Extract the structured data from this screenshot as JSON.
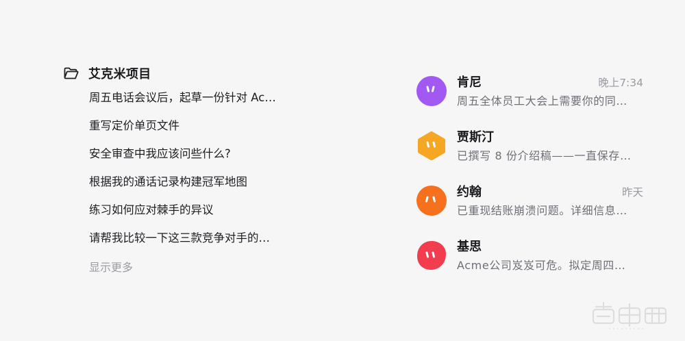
{
  "project": {
    "icon": "folder-open-icon",
    "title": "艾克米项目",
    "threads": [
      "周五电话会议后，起草一份针对 Ac…",
      "重写定价单页文件",
      "安全审查中我应该问些什么?",
      "根据我的通话记录构建冠军地图",
      "练习如何应对棘手的异议",
      "请帮我比较一下这三款竞争对手的…"
    ],
    "show_more": "显示更多"
  },
  "chats": [
    {
      "name": "肯尼",
      "time": "晚上7:34",
      "preview": "周五全体员工大会上需要你的同…",
      "avatar_color": "#a259f4",
      "avatar_shape": "circle"
    },
    {
      "name": "贾斯汀",
      "time": "",
      "preview": "已撰写 8 份介绍稿——一直保存…",
      "avatar_color": "#f5a623",
      "avatar_shape": "hexagon"
    },
    {
      "name": "约翰",
      "time": "昨天",
      "preview": "已重现结账崩溃问题。详细信息…",
      "avatar_color": "#f7711d",
      "avatar_shape": "circle"
    },
    {
      "name": "基思",
      "time": "",
      "preview": "Acme公司岌岌可危。拟定周四…",
      "avatar_color": "#f23d4f",
      "avatar_shape": "blob"
    }
  ],
  "watermark": {
    "text": "智东西",
    "sub": "zhidx.com"
  }
}
